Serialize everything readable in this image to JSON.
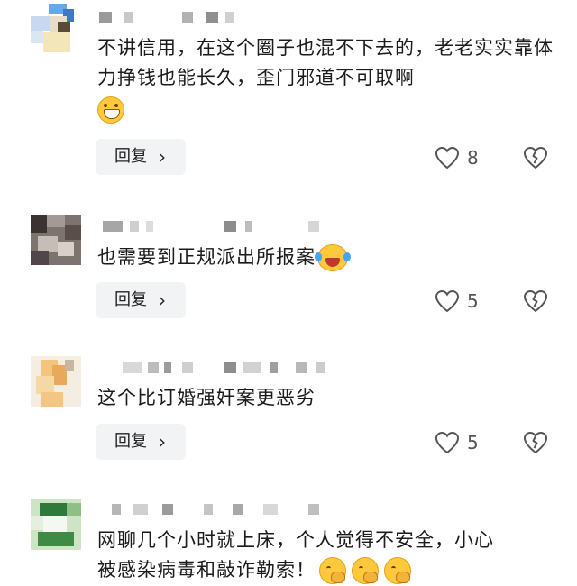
{
  "comments": [
    {
      "text": "不讲信用，在这个圈子也混不下去的，老老实实靠体力挣钱也能长久，歪门邪道不可取啊",
      "emoji": "grinning-face",
      "reply_label": "回复",
      "like_count": "8"
    },
    {
      "text": "也需要到正规派出所报案",
      "emoji": "rolling-on-floor-laughing",
      "reply_label": "回复",
      "like_count": "5"
    },
    {
      "text": "这个比订婚强奸案更恶劣",
      "emoji": "",
      "reply_label": "回复",
      "like_count": "5"
    },
    {
      "text_line1": "网聊几个小时就上床，个人觉得不安全，小心",
      "text_line2": "被感染病毒和敲诈勒索！",
      "emoji": "face-with-hand-over-mouth",
      "reply_label": "",
      "like_count": ""
    }
  ],
  "icons": {
    "reply_chevron": "chevron-right-icon",
    "like": "heart-outline-icon",
    "dislike": "broken-heart-icon"
  },
  "colors": {
    "reply_bg": "#f2f3f5",
    "icon_stroke": "#555555"
  }
}
